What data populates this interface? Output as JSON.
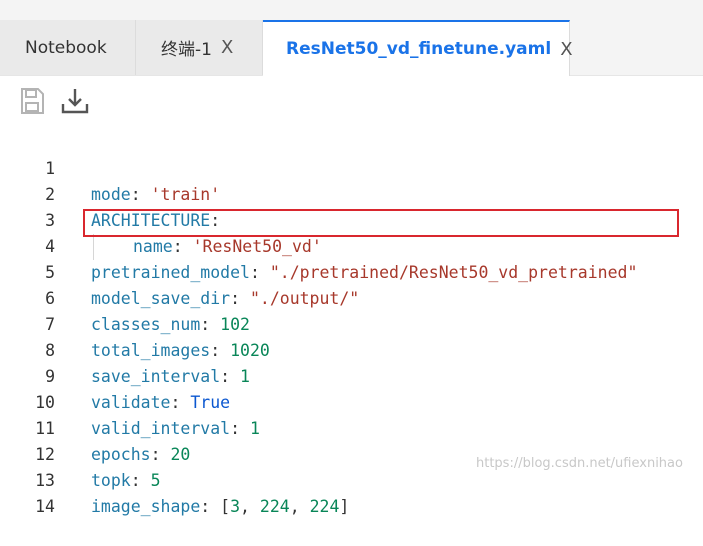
{
  "tabs": [
    {
      "label": "Notebook"
    },
    {
      "label": "终端-1",
      "close": "X"
    },
    {
      "label": "ResNet50_vd_finetune.yaml",
      "close": "X"
    }
  ],
  "toolbar": {
    "icons": [
      "save-icon",
      "download-icon"
    ]
  },
  "code_lines": [
    {
      "num": "1",
      "key": "mode",
      "sep": ": ",
      "value": "'train'"
    },
    {
      "num": "2",
      "key": "ARCHITECTURE",
      "sep": ":"
    },
    {
      "num": "3",
      "key": "name",
      "sep": ": ",
      "value": "'ResNet50_vd'"
    },
    {
      "num": "4",
      "key": "pretrained_model",
      "sep": ": ",
      "value": "\"./pretrained/ResNet50_vd_pretrained\""
    },
    {
      "num": "5",
      "key": "model_save_dir",
      "sep": ": ",
      "value": "\"./output/\""
    },
    {
      "num": "6",
      "key": "classes_num",
      "sep": ": ",
      "value": "102"
    },
    {
      "num": "7",
      "key": "total_images",
      "sep": ": ",
      "value": "1020"
    },
    {
      "num": "8",
      "key": "save_interval",
      "sep": ": ",
      "value": "1"
    },
    {
      "num": "9",
      "key": "validate",
      "sep": ": ",
      "value": "True"
    },
    {
      "num": "10",
      "key": "valid_interval",
      "sep": ": ",
      "value": "1"
    },
    {
      "num": "11",
      "key": "epochs",
      "sep": ": ",
      "value": "20"
    },
    {
      "num": "12",
      "key": "topk",
      "sep": ": ",
      "value": "5"
    },
    {
      "num": "13",
      "key": "image_shape",
      "sep": ": ",
      "value_parts": [
        "[",
        "3",
        ", ",
        "224",
        ", ",
        "224",
        "]"
      ]
    },
    {
      "num": "14"
    }
  ],
  "watermark": "https://blog.csdn.net/ufiexnihao",
  "colors": {
    "accent": "#1a73e8",
    "highlight_border": "#d9272e"
  }
}
